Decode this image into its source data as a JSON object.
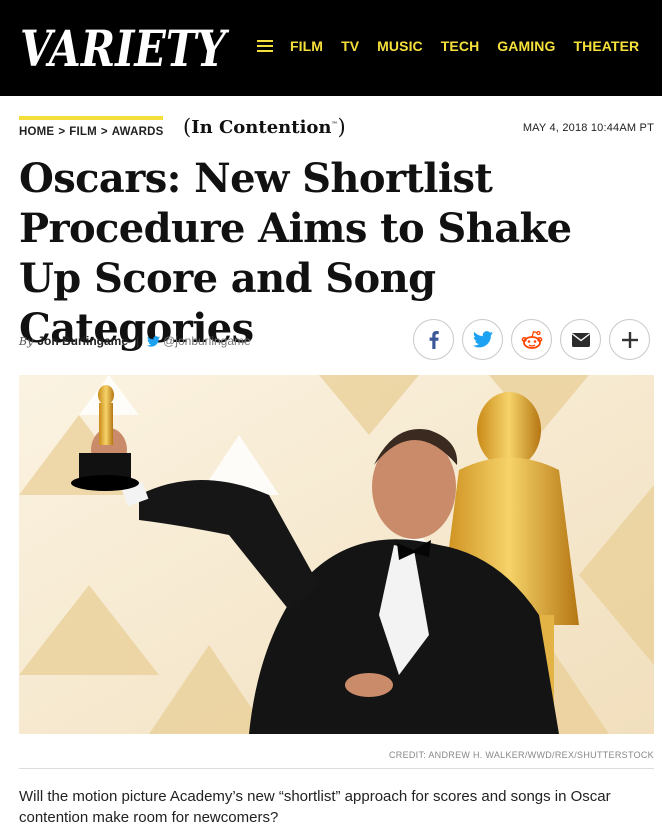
{
  "header": {
    "logo_text": "VARIETY",
    "nav": [
      "FILM",
      "TV",
      "MUSIC",
      "TECH",
      "GAMING",
      "THEATER"
    ]
  },
  "breadcrumb": {
    "items": [
      "HOME",
      "FILM",
      "AWARDS"
    ],
    "separator": ">"
  },
  "column": {
    "name": "In Contention",
    "mark": "™"
  },
  "date": "MAY 4, 2018 10:44AM PT",
  "headline": "Oscars: New Shortlist Procedure Aims to Shake Up Score and Song Categories",
  "byline": {
    "prefix": "By",
    "author": "Jon Burlingame",
    "separator": "|",
    "handle": "@jonburlingame"
  },
  "share": {
    "icons": [
      "facebook-icon",
      "twitter-icon",
      "reddit-icon",
      "email-icon",
      "plus-icon"
    ]
  },
  "image": {
    "credit": "CREDIT: ANDREW H. WALKER/WWD/REX/SHUTTERSTOCK"
  },
  "lede": "Will the motion picture Academy’s new “shortlist” approach for scores and songs in Oscar contention make room for newcomers?",
  "colors": {
    "brand_yellow": "#f5e03b",
    "header_bg": "#000000",
    "facebook": "#3b5998",
    "twitter": "#1da1f2",
    "reddit": "#ff4500"
  }
}
